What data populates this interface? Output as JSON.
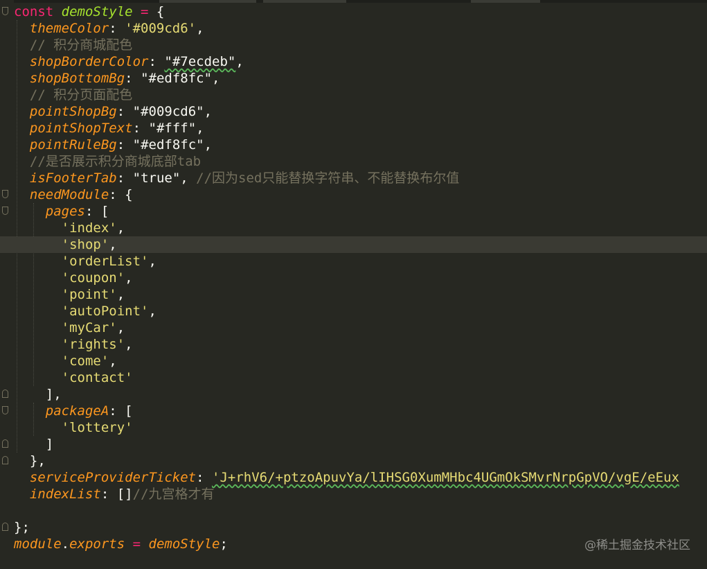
{
  "lines": [
    [
      {
        "c": "kw",
        "t": "const "
      },
      {
        "c": "def",
        "t": "demoStyle"
      },
      {
        "c": "op",
        "t": " = "
      },
      {
        "c": "pun",
        "t": "{"
      }
    ],
    [
      {
        "c": "pun",
        "t": "  "
      },
      {
        "c": "prop",
        "t": "themeColor"
      },
      {
        "c": "pun",
        "t": ": "
      },
      {
        "c": "str",
        "t": "'#009cd6'"
      },
      {
        "c": "pun",
        "t": ","
      }
    ],
    [
      {
        "c": "cm",
        "t": "  // 积分商城配色"
      }
    ],
    [
      {
        "c": "pun",
        "t": "  "
      },
      {
        "c": "prop",
        "t": "shopBorderColor"
      },
      {
        "c": "pun",
        "t": ": "
      },
      {
        "c": "strw",
        "t": "\"#7ecdeb\""
      },
      {
        "c": "pun",
        "t": ","
      }
    ],
    [
      {
        "c": "pun",
        "t": "  "
      },
      {
        "c": "prop",
        "t": "shopBottomBg"
      },
      {
        "c": "pun",
        "t": ": "
      },
      {
        "c": "strw",
        "t": "\"#edf8fc\""
      },
      {
        "c": "pun",
        "t": ","
      }
    ],
    [
      {
        "c": "cm",
        "t": "  // 积分页面配色"
      }
    ],
    [
      {
        "c": "pun",
        "t": "  "
      },
      {
        "c": "prop",
        "t": "pointShopBg"
      },
      {
        "c": "pun",
        "t": ": "
      },
      {
        "c": "strw",
        "t": "\"#009cd6\""
      },
      {
        "c": "pun",
        "t": ","
      }
    ],
    [
      {
        "c": "pun",
        "t": "  "
      },
      {
        "c": "prop",
        "t": "pointShopText"
      },
      {
        "c": "pun",
        "t": ": "
      },
      {
        "c": "strw",
        "t": "\"#fff\""
      },
      {
        "c": "pun",
        "t": ","
      }
    ],
    [
      {
        "c": "pun",
        "t": "  "
      },
      {
        "c": "prop",
        "t": "pointRuleBg"
      },
      {
        "c": "pun",
        "t": ": "
      },
      {
        "c": "strw",
        "t": "\"#edf8fc\""
      },
      {
        "c": "pun",
        "t": ","
      }
    ],
    [
      {
        "c": "cm",
        "t": "  //是否展示积分商城底部tab"
      }
    ],
    [
      {
        "c": "pun",
        "t": "  "
      },
      {
        "c": "prop",
        "t": "isFooterTab"
      },
      {
        "c": "pun",
        "t": ": "
      },
      {
        "c": "strw",
        "t": "\"true\""
      },
      {
        "c": "pun",
        "t": ", "
      },
      {
        "c": "cm",
        "t": "//因为sed只能替换字符串、不能替换布尔值"
      }
    ],
    [
      {
        "c": "pun",
        "t": "  "
      },
      {
        "c": "prop",
        "t": "needModule"
      },
      {
        "c": "pun",
        "t": ": {"
      }
    ],
    [
      {
        "c": "pun",
        "t": "    "
      },
      {
        "c": "prop",
        "t": "pages"
      },
      {
        "c": "pun",
        "t": ": ["
      }
    ],
    [
      {
        "c": "pun",
        "t": "      "
      },
      {
        "c": "str",
        "t": "'index'"
      },
      {
        "c": "pun",
        "t": ","
      }
    ],
    [
      {
        "c": "pun",
        "t": "      "
      },
      {
        "c": "str",
        "t": "'shop'"
      },
      {
        "c": "pun",
        "t": ","
      }
    ],
    [
      {
        "c": "pun",
        "t": "      "
      },
      {
        "c": "str",
        "t": "'orderList'"
      },
      {
        "c": "pun",
        "t": ","
      }
    ],
    [
      {
        "c": "pun",
        "t": "      "
      },
      {
        "c": "str",
        "t": "'coupon'"
      },
      {
        "c": "pun",
        "t": ","
      }
    ],
    [
      {
        "c": "pun",
        "t": "      "
      },
      {
        "c": "str",
        "t": "'point'"
      },
      {
        "c": "pun",
        "t": ","
      }
    ],
    [
      {
        "c": "pun",
        "t": "      "
      },
      {
        "c": "str",
        "t": "'autoPoint'"
      },
      {
        "c": "pun",
        "t": ","
      }
    ],
    [
      {
        "c": "pun",
        "t": "      "
      },
      {
        "c": "str",
        "t": "'myCar'"
      },
      {
        "c": "pun",
        "t": ","
      }
    ],
    [
      {
        "c": "pun",
        "t": "      "
      },
      {
        "c": "str",
        "t": "'rights'"
      },
      {
        "c": "pun",
        "t": ","
      }
    ],
    [
      {
        "c": "pun",
        "t": "      "
      },
      {
        "c": "str",
        "t": "'come'"
      },
      {
        "c": "pun",
        "t": ","
      }
    ],
    [
      {
        "c": "pun",
        "t": "      "
      },
      {
        "c": "str",
        "t": "'contact'"
      }
    ],
    [
      {
        "c": "pun",
        "t": "    ],"
      }
    ],
    [
      {
        "c": "pun",
        "t": "    "
      },
      {
        "c": "prop",
        "t": "packageA"
      },
      {
        "c": "pun",
        "t": ": ["
      }
    ],
    [
      {
        "c": "pun",
        "t": "      "
      },
      {
        "c": "str",
        "t": "'lottery'"
      }
    ],
    [
      {
        "c": "pun",
        "t": "    ]"
      }
    ],
    [
      {
        "c": "pun",
        "t": "  },"
      }
    ],
    [
      {
        "c": "pun",
        "t": "  "
      },
      {
        "c": "prop",
        "t": "serviceProviderTicket"
      },
      {
        "c": "pun",
        "t": ": "
      },
      {
        "c": "str",
        "t": "'J+rhV6/+ptzoApuvYa/lIHSG0XumMHbc4UGmOkSMvrNrpGpVO/vgE/eEux"
      }
    ],
    [
      {
        "c": "pun",
        "t": "  "
      },
      {
        "c": "prop",
        "t": "indexList"
      },
      {
        "c": "pun",
        "t": ": "
      },
      {
        "c": "pun",
        "t": "[]"
      },
      {
        "c": "cm",
        "t": "//九宫格才有"
      }
    ],
    [
      {
        "c": "pun",
        "t": ""
      }
    ],
    [
      {
        "c": "pun",
        "t": "};"
      }
    ],
    [
      {
        "c": "mod",
        "t": "module"
      },
      {
        "c": "pun",
        "t": "."
      },
      {
        "c": "mod",
        "t": "exports"
      },
      {
        "c": "op",
        "t": " = "
      },
      {
        "c": "mod",
        "t": "demoStyle"
      },
      {
        "c": "pun",
        "t": ";"
      }
    ]
  ],
  "current_line": 14,
  "watermark": "@稀土掘金技术社区",
  "colors": {
    "background": "#272822",
    "keyword": "#f92672",
    "property": "#fd971f",
    "string": "#e6db74",
    "comment": "#75715e",
    "function": "#a6e22e",
    "current_line": "#3a3a33"
  }
}
